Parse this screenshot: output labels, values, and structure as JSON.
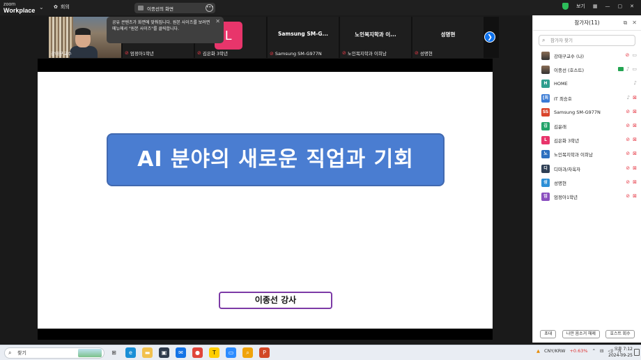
{
  "app": {
    "logo_top": "zoom",
    "logo_bottom": "Workplace",
    "meeting_label": "회의"
  },
  "share_pill": {
    "label": "이종선의 화면"
  },
  "topbar": {
    "view_label": "보기"
  },
  "strip": {
    "tiles": [
      {
        "name": "강태구교수",
        "muted": false
      },
      {
        "name": "엄정아1학년",
        "muted": true
      },
      {
        "name": "김은화 3학년",
        "muted": true,
        "avatar_letter": "L",
        "avatar_color": "#e8356b"
      },
      {
        "name": "Samsung SM-G977N",
        "big": "Samsung  SM-G...",
        "muted": true
      },
      {
        "name": "노인복지학과 이희남",
        "big": "노인복지학과  이...",
        "muted": true
      },
      {
        "name": "성명현",
        "big": "성명현",
        "muted": true
      }
    ],
    "toast": "공유 콘텐츠가 화면에 맞춰집니다. 원본 사이즈를 보려면 메뉴에서 \"원본 사이즈\"를 클릭합니다."
  },
  "slide": {
    "title": "AI 분야의 새로운 직업과 기회",
    "lecturer": "이종선 강사",
    "title_bg": "#4a7dd1",
    "lecturer_border": "#7c3aa6"
  },
  "panel": {
    "title": "참가자(11)",
    "search_placeholder": "참가자 찾기",
    "participants": [
      {
        "initial": "",
        "color": "",
        "photo": true,
        "name": "강태구교수 (나)",
        "mic": "off",
        "cam": "on"
      },
      {
        "initial": "",
        "color": "",
        "photo": true,
        "name": "이종선 (호스트)",
        "mic": "on",
        "cam": "on",
        "sharing": true
      },
      {
        "initial": "H",
        "color": "#2f9e8f",
        "name": "HOME",
        "mic": "on",
        "cam": "none"
      },
      {
        "initial": "[최",
        "color": "#3a7bd5",
        "name": "IT 최승호",
        "mic": "on",
        "cam": "off"
      },
      {
        "initial": "SS",
        "color": "#d9452b",
        "name": "Samsung SM-G977N",
        "mic": "off",
        "cam": "off"
      },
      {
        "initial": "김",
        "color": "#23a36a",
        "name": "김윤래",
        "mic": "off",
        "cam": "off"
      },
      {
        "initial": "L",
        "color": "#e8356b",
        "name": "김은화 3학년",
        "mic": "off",
        "cam": "off"
      },
      {
        "initial": "노",
        "color": "#2c6fbf",
        "name": "노인복지학과 이희남",
        "mic": "off",
        "cam": "off"
      },
      {
        "initial": "디",
        "color": "#2e3f55",
        "name": "디마과/차옥자",
        "mic": "off",
        "cam": "off"
      },
      {
        "initial": "성",
        "color": "#2d8fd6",
        "name": "성명현",
        "mic": "off",
        "cam": "off"
      },
      {
        "initial": "엄",
        "color": "#8a4fbf",
        "name": "엄정아1학년",
        "mic": "off",
        "cam": "off"
      }
    ],
    "footer": [
      "초대",
      "나만 음소거 해제",
      "호스트 회수"
    ]
  },
  "taskbar": {
    "search": "찾기",
    "currency": "CNY/KRW",
    "change": "+0.63%",
    "ime": "가",
    "time": "오후 7:12",
    "date": "2024-09-25"
  }
}
